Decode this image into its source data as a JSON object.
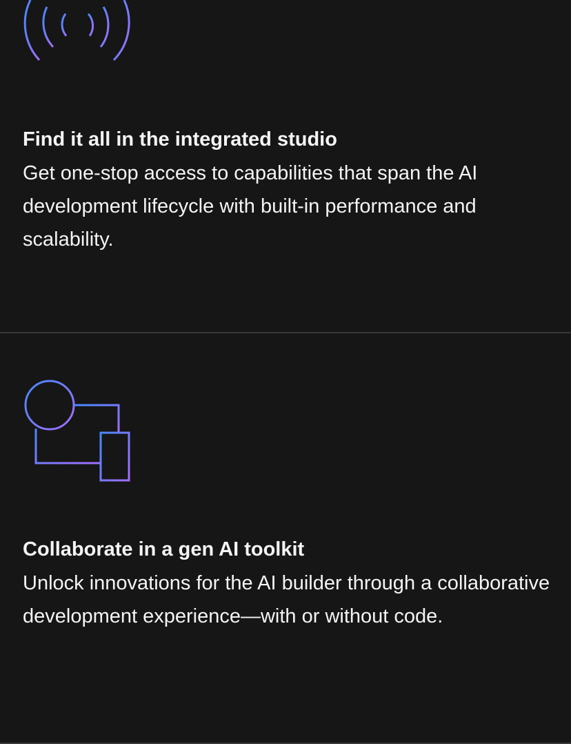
{
  "features": [
    {
      "icon": "broadcast-signal-icon",
      "title": "Find it all in the integrated studio",
      "description": "Get one-stop access to capabilities that span the AI development lifecycle with built-in performance and scalability."
    },
    {
      "icon": "add-device-icon",
      "title": "Collaborate in a gen AI toolkit",
      "description": "Unlock innovations for the AI builder through a collaborative development experience—with or without code."
    }
  ],
  "colors": {
    "background": "#161616",
    "text": "#f4f4f4",
    "divider": "#393939",
    "icon_gradient_start": "#4589ff",
    "icon_gradient_end": "#a56eff"
  }
}
